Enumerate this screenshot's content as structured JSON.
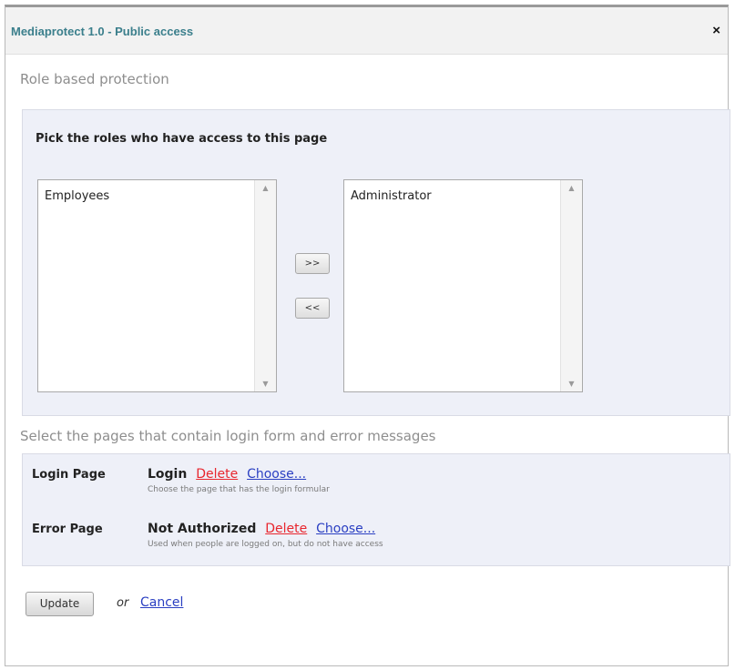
{
  "window": {
    "title": "Mediaprotect 1.0 - Public access",
    "close_label": "×"
  },
  "roles_section": {
    "heading": "Role based protection",
    "instruction": "Pick the roles who have access to this page",
    "available_roles": [
      "Employees"
    ],
    "selected_roles": [
      "Administrator"
    ],
    "add_button_label": ">>",
    "remove_button_label": "<<"
  },
  "pages_section": {
    "heading": "Select the pages that contain login form and error messages",
    "login": {
      "label": "Login Page",
      "value": "Login",
      "delete_label": "Delete",
      "choose_label": "Choose...",
      "hint": "Choose the page that has the login formular"
    },
    "error": {
      "label": "Error Page",
      "value": "Not Authorized",
      "delete_label": "Delete",
      "choose_label": "Choose...",
      "hint": "Used when people are logged on, but do not have access"
    }
  },
  "actions": {
    "update_label": "Update",
    "or_text": "or",
    "cancel_label": "Cancel"
  },
  "colors": {
    "title": "#3b7f8c",
    "panel_background": "#eef0f8",
    "delete_link": "#e8262e",
    "choose_link": "#2a3fc2"
  }
}
